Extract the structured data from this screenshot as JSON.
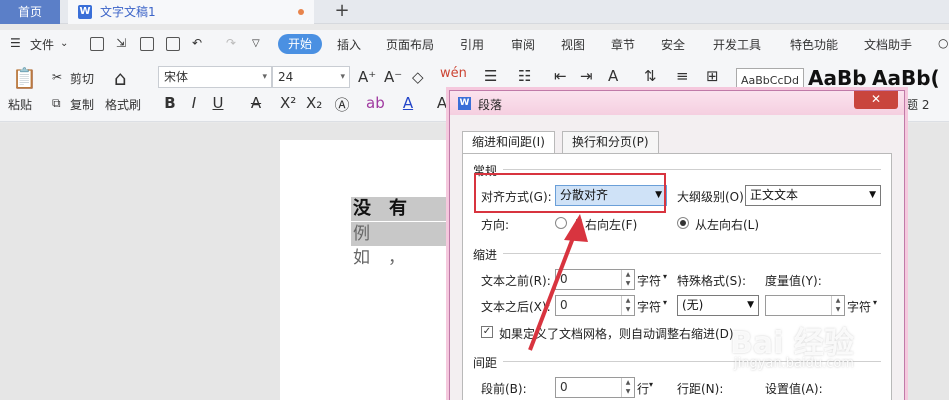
{
  "tabs": {
    "home": "首页",
    "doc": "文字文稿1",
    "plus": "+"
  },
  "menu": {
    "file": "文件",
    "start": "开始",
    "items": [
      "插入",
      "页面布局",
      "引用",
      "审阅",
      "视图",
      "章节",
      "安全",
      "开发工具",
      "特色功能",
      "文档助手"
    ]
  },
  "ribbon": {
    "paste": "粘贴",
    "cut": "剪切",
    "copy": "复制",
    "format_painter": "格式刷",
    "font": "宋体",
    "size": "24",
    "style_sample": "AaBbCcDd",
    "style_big1": "AaBb",
    "style_big2": "AaBb(",
    "heading2": "题 2"
  },
  "document": {
    "line1": "没有勇",
    "line2": "例如，"
  },
  "dialog": {
    "title": "段落",
    "close": "✕",
    "tab_indent": "缩进和间距(I)",
    "tab_flow": "换行和分页(P)",
    "section_general": "常规",
    "align_label": "对齐方式(G):",
    "align_value": "分散对齐",
    "outline_label": "大纲级别(O):",
    "outline_value": "正文文本",
    "direction_label": "方向:",
    "rtl": "从右向左(F)",
    "ltr": "从左向右(L)",
    "section_indent": "缩进",
    "before_text": "文本之前(R):",
    "before_value": "0",
    "after_text": "文本之后(X):",
    "after_value": "0",
    "unit_char": "字符",
    "special_label": "特殊格式(S):",
    "special_value": "(无)",
    "measure_label": "度量值(Y):",
    "grid_check": "如果定义了文档网格，则自动调整右缩进(D)",
    "section_spacing": "间距",
    "space_before": "段前(B):",
    "space_before_value": "0",
    "unit_line": "行",
    "line_spacing": "行距(N):",
    "setting_value": "设置值(A):"
  },
  "watermark": {
    "main": "Bai 经验",
    "sub": "jingyan.baidu.com"
  }
}
